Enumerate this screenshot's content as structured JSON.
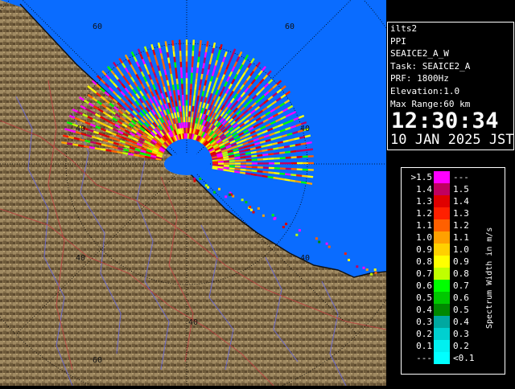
{
  "radar_info": {
    "site": "ilts2",
    "product": "PPI",
    "scan": "SEAICE2_A_W",
    "task": "Task: SEAICE2_A",
    "prf": "PRF: 1800Hz",
    "elevation": "Elevation:1.0",
    "max_range": "Max Range:60 km",
    "time": "12:30:34",
    "date": "10 JAN 2025 JST"
  },
  "range_ring_labels": [
    "60",
    "60",
    "40",
    "40",
    "40",
    "40",
    "40",
    "60"
  ],
  "legend": {
    "title": "Spectrum Width in m/s",
    "rows": [
      {
        "low": ">1.5",
        "high": "---",
        "color": "#ff00ff"
      },
      {
        "low": "1.4",
        "high": "1.5",
        "color": "#c00060"
      },
      {
        "low": "1.3",
        "high": "1.4",
        "color": "#e00000"
      },
      {
        "low": "1.2",
        "high": "1.3",
        "color": "#ff2000"
      },
      {
        "low": "1.1",
        "high": "1.2",
        "color": "#ff6000"
      },
      {
        "low": "1.0",
        "high": "1.1",
        "color": "#ffa000"
      },
      {
        "low": "0.9",
        "high": "1.0",
        "color": "#ffd000"
      },
      {
        "low": "0.8",
        "high": "0.9",
        "color": "#ffff00"
      },
      {
        "low": "0.7",
        "high": "0.8",
        "color": "#c0ff00"
      },
      {
        "low": "0.6",
        "high": "0.7",
        "color": "#00ff00"
      },
      {
        "low": "0.5",
        "high": "0.6",
        "color": "#00c800"
      },
      {
        "low": "0.4",
        "high": "0.5",
        "color": "#008800"
      },
      {
        "low": "0.3",
        "high": "0.4",
        "color": "#00a8a0"
      },
      {
        "low": "0.2",
        "high": "0.3",
        "color": "#00d0d0"
      },
      {
        "low": "0.1",
        "high": "0.2",
        "color": "#00f0f0"
      },
      {
        "low": "---",
        "high": "<0.1",
        "color": "#00ffff"
      }
    ]
  },
  "colors": {
    "sea": "#0a6cff",
    "land": "#8b7650",
    "rivers": "#6a6ad8",
    "boundaries": "#c04040",
    "coastline": "#111111"
  }
}
